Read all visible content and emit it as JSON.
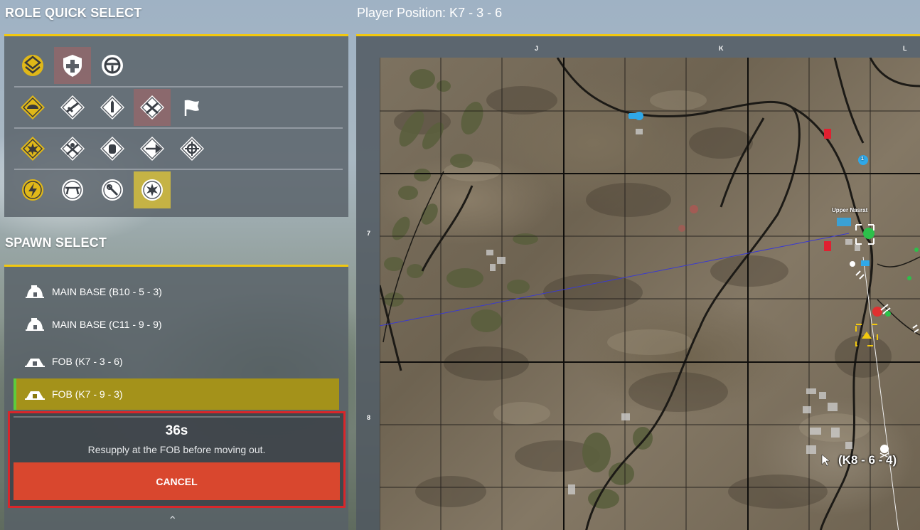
{
  "role_quick_select": {
    "title": "ROLE QUICK SELECT",
    "rows": [
      [
        {
          "icon": "squad-leader-icon",
          "state": "none"
        },
        {
          "icon": "medic-icon",
          "state": "selected-red"
        },
        {
          "icon": "driver-wheel-icon",
          "state": "none"
        }
      ],
      [
        {
          "icon": "rifleman-helmet-icon",
          "state": "none"
        },
        {
          "icon": "automatic-rifleman-icon",
          "state": "none"
        },
        {
          "icon": "ammo-icon",
          "state": "none"
        },
        {
          "icon": "crossed-rifles-icon",
          "state": "selected-red"
        },
        {
          "icon": "flag-icon",
          "state": "none"
        }
      ],
      [
        {
          "icon": "explosion-icon",
          "state": "none"
        },
        {
          "icon": "grenadier-icon",
          "state": "none"
        },
        {
          "icon": "engineer-icon",
          "state": "none"
        },
        {
          "icon": "rocket-icon",
          "state": "none"
        },
        {
          "icon": "target-cross-icon",
          "state": "none"
        }
      ],
      [
        {
          "icon": "lightning-icon",
          "state": "none"
        },
        {
          "icon": "machine-gun-icon",
          "state": "none"
        },
        {
          "icon": "sniper-icon",
          "state": "none"
        },
        {
          "icon": "heavy-weapons-icon",
          "state": "selected-gold"
        }
      ]
    ]
  },
  "spawn_select": {
    "title": "SPAWN SELECT",
    "items": [
      {
        "label": "MAIN BASE (B10 - 5 - 3)",
        "icon": "main-base-icon",
        "active": false
      },
      {
        "label": "MAIN BASE (C11 - 9 - 9)",
        "icon": "main-base-icon",
        "active": false
      },
      {
        "label": "FOB (K7 - 3 - 6)",
        "icon": "fob-icon",
        "active": false
      },
      {
        "label": "FOB (K7 - 9 - 3)",
        "icon": "fob-icon",
        "active": true
      }
    ],
    "timer": "36s",
    "message": "Resupply at the FOB before moving out.",
    "cancel_label": "CANCEL"
  },
  "map": {
    "player_position": "Player Position: K7 - 3 - 6",
    "columns": [
      "J",
      "K",
      "L"
    ],
    "rows": [
      "7",
      "8"
    ],
    "place_name": "Upper Nasrat",
    "cursor_coord": "(K8 - 6 - 4)",
    "marker_label": "1"
  },
  "colors": {
    "accent_yellow": "#f2c80f",
    "selected_gold": "#d6be3c",
    "active_spawn": "#aa9614",
    "active_marker_green": "#5dcc3c",
    "cancel_red": "#d9472e",
    "highlight_border_red": "#d9262a"
  }
}
